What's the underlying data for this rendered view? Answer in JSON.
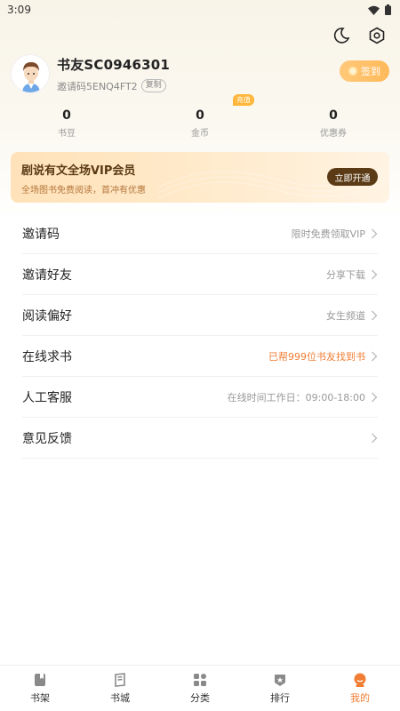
{
  "status_bar": {
    "time": "3:09"
  },
  "profile": {
    "username": "书友SC0946301",
    "invite_code": "邀请码5ENQ4FT2",
    "copy_label": "复制",
    "checkin_label": "签到"
  },
  "stats": [
    {
      "value": "0",
      "label": "书豆"
    },
    {
      "value": "0",
      "label": "金币",
      "badge": "充值"
    },
    {
      "value": "0",
      "label": "优惠券"
    }
  ],
  "vip": {
    "title": "剧说有文全场VIP会员",
    "subtitle": "全场图书免费阅读，首冲有优惠",
    "button": "立即开通"
  },
  "menu": [
    {
      "label": "邀请码",
      "value": "限时免费领取VIP"
    },
    {
      "label": "邀请好友",
      "value": "分享下载"
    },
    {
      "label": "阅读偏好",
      "value": "女生频道"
    },
    {
      "label": "在线求书",
      "value": "已帮999位书友找到书"
    },
    {
      "label": "人工客服",
      "value": "在线时间工作日：09:00-18:00"
    },
    {
      "label": "意见反馈",
      "value": ""
    }
  ],
  "tabs": [
    {
      "label": "书架",
      "icon": "bookshelf-icon"
    },
    {
      "label": "书城",
      "icon": "bookstore-icon"
    },
    {
      "label": "分类",
      "icon": "category-icon"
    },
    {
      "label": "排行",
      "icon": "ranking-icon"
    },
    {
      "label": "我的",
      "icon": "profile-icon"
    }
  ],
  "colors": {
    "accent": "#f07d33",
    "vip_button": "#5b3b16",
    "checkin": "#ffb95a"
  }
}
